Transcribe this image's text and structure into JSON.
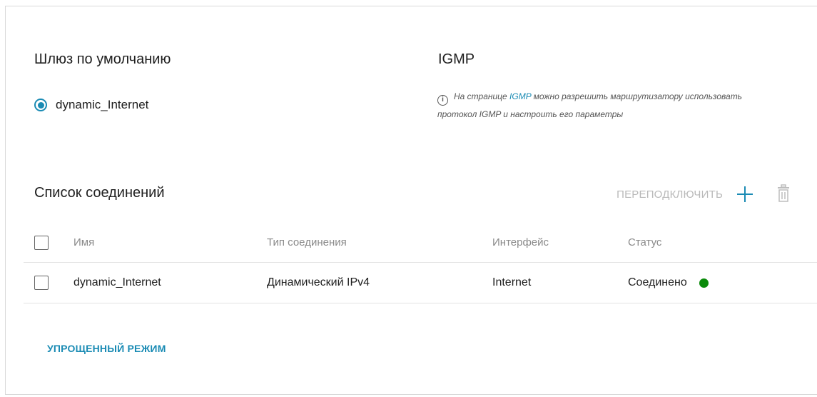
{
  "gateway": {
    "title": "Шлюз по умолчанию",
    "selected_label": "dynamic_Internet"
  },
  "igmp": {
    "title": "IGMP",
    "note_before": "На странице ",
    "note_link": "IGMP",
    "note_after": " можно разрешить маршрутизатору использовать протокол IGMP и настроить его параметры"
  },
  "connections": {
    "title": "Список соединений",
    "reconnect_label": "ПЕРЕПОДКЛЮЧИТЬ",
    "columns": {
      "name": "Имя",
      "type": "Тип соединения",
      "interface": "Интерфейс",
      "status": "Статус"
    },
    "rows": [
      {
        "name": "dynamic_Internet",
        "type": "Динамический IPv4",
        "interface": "Internet",
        "status": "Соединено",
        "status_color": "#0a8a0a"
      }
    ]
  },
  "simple_mode_label": "УПРОЩЕННЫЙ РЕЖИМ",
  "colors": {
    "accent": "#1a8bb4",
    "status_connected": "#0a8a0a",
    "disabled": "#b9b9b9"
  },
  "icons": {
    "info": "info-icon",
    "add": "plus-icon",
    "delete": "trash-icon",
    "radio": "radio-selected"
  }
}
